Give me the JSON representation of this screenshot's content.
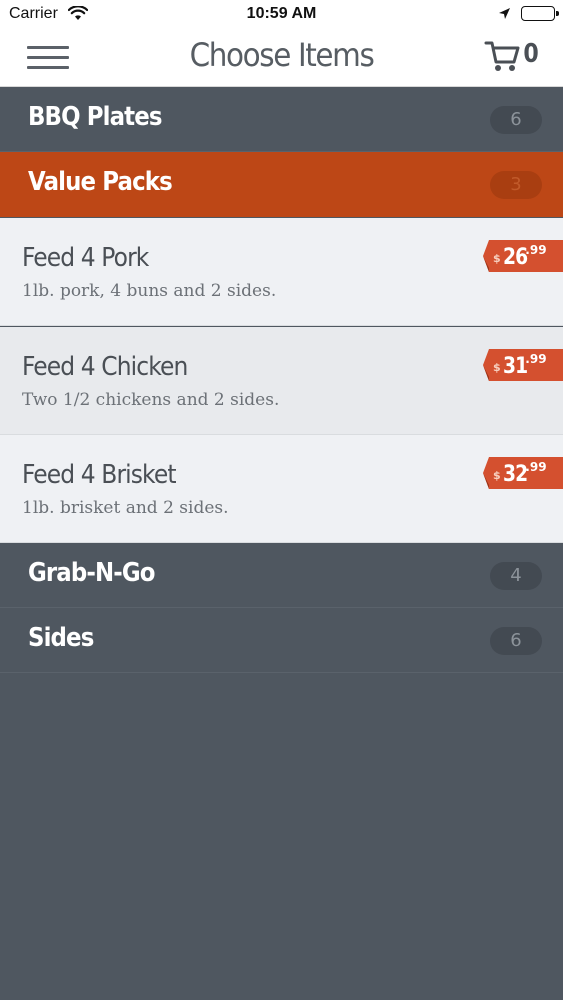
{
  "status_bar": {
    "carrier": "Carrier",
    "time": "10:59 AM"
  },
  "nav": {
    "title": "Choose Items",
    "cart_count": "0"
  },
  "categories": [
    {
      "label": "BBQ Plates",
      "count": "6"
    },
    {
      "label": "Value Packs",
      "count": "3"
    },
    {
      "label": "Grab-N-Go",
      "count": "4"
    },
    {
      "label": "Sides",
      "count": "6"
    }
  ],
  "items": [
    {
      "name": "Feed 4 Pork",
      "description": "1lb. pork, 4 buns and 2 sides.",
      "price_currency": "$",
      "price_main": "26",
      "price_cents": ".99"
    },
    {
      "name": "Feed 4 Chicken",
      "description": "Two 1/2 chickens and 2 sides.",
      "price_currency": "$",
      "price_main": "31",
      "price_cents": ".99"
    },
    {
      "name": "Feed 4 Brisket",
      "description": "1lb. brisket and 2 sides.",
      "price_currency": "$",
      "price_main": "32",
      "price_cents": ".99"
    }
  ],
  "colors": {
    "accent": "#bd4716",
    "price_tag": "#d4502f",
    "background": "#4f5760"
  },
  "icons": {
    "menu": "hamburger-icon",
    "cart": "cart-icon",
    "wifi": "wifi-icon",
    "location": "location-arrow-icon",
    "battery": "battery-icon"
  }
}
